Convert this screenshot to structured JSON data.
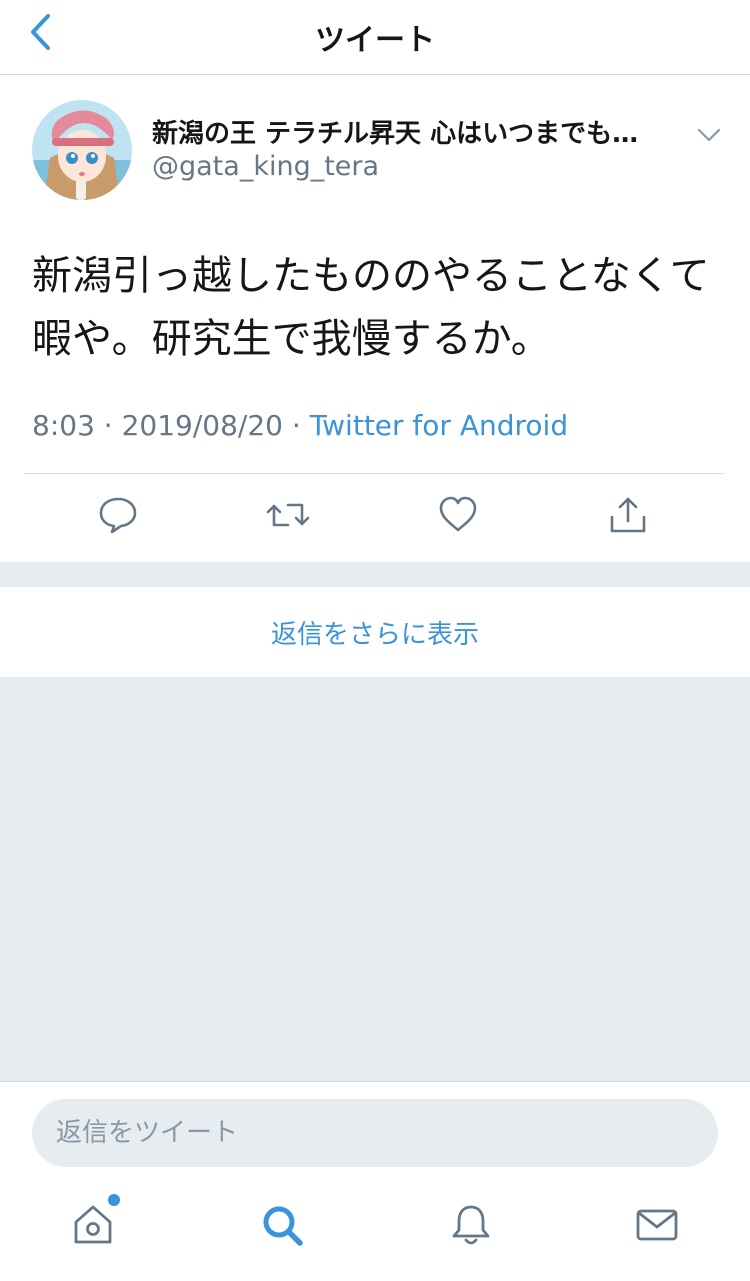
{
  "header": {
    "title": "ツイート"
  },
  "tweet": {
    "display_name": "新潟の王 テラチル昇天 心はいつまでも…",
    "handle": "@gata_king_tera",
    "text": "新潟引っ越したもののやることなくて暇や。研究生で我慢するか。",
    "time": "8:03",
    "separator1": " · ",
    "date": "2019/08/20",
    "separator2": " · ",
    "source": "Twitter for Android"
  },
  "more_replies": {
    "label": "返信をさらに表示"
  },
  "reply": {
    "placeholder": "返信をツイート"
  },
  "colors": {
    "accent": "#3b94d9",
    "secondary_text": "#657786",
    "background": "#e6ecf0"
  },
  "icons": {
    "back": "chevron-left-icon",
    "caret": "chevron-down-icon",
    "reply": "reply-icon",
    "retweet": "retweet-icon",
    "like": "heart-icon",
    "share": "share-icon",
    "home": "home-icon",
    "search": "search-icon",
    "notifications": "bell-icon",
    "messages": "mail-icon"
  }
}
